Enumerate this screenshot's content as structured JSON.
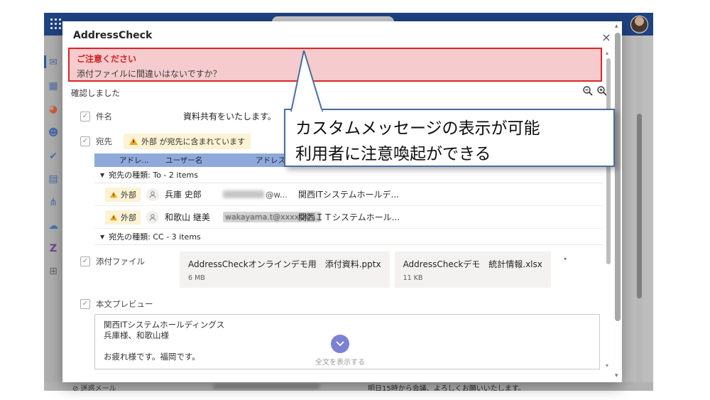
{
  "header": {
    "app_launcher": "app-launcher",
    "search_placeholder": ""
  },
  "sidebar": {
    "items": [
      {
        "name": "mail",
        "glyph": "✉"
      },
      {
        "name": "calendar",
        "glyph": "▦"
      },
      {
        "name": "office",
        "glyph": "◕"
      },
      {
        "name": "people",
        "glyph": "☻"
      },
      {
        "name": "todo",
        "glyph": "✔"
      },
      {
        "name": "notebook",
        "glyph": "▤"
      },
      {
        "name": "org",
        "glyph": "⋔"
      },
      {
        "name": "cloud",
        "glyph": "☁"
      },
      {
        "name": "app-z",
        "glyph": "Z"
      },
      {
        "name": "apps-grid",
        "glyph": "⊞"
      }
    ]
  },
  "dialog": {
    "title": "AddressCheck",
    "close_glyph": "×",
    "banner": {
      "title": "ご注意ください",
      "message": "添付ファイルに間違いはないですか？"
    },
    "confirmed_label": "確認しました",
    "subject": {
      "label": "件名",
      "value": "資料共有をいたします。"
    },
    "recipients": {
      "label": "宛先",
      "warning": "外部 が宛先に含まれています",
      "table_headers": [
        "アドレ...",
        "ユーザー名",
        "アドレス"
      ],
      "groups": [
        {
          "label": "宛先の種類: To - 2 items",
          "rows": [
            {
              "badge": "外部",
              "name": "兵庫 史郎",
              "email_visible": "@w...",
              "company": "関西ITシステムホールデ..."
            },
            {
              "badge": "外部",
              "name": "和歌山 継美",
              "email_visible": "wakayama.t@xxxxOO...",
              "company": "関西ＩＴシステムホール..."
            }
          ]
        },
        {
          "label": "宛先の種類: CC - 3 items"
        }
      ]
    },
    "attachments": {
      "label": "添付ファイル",
      "files": [
        {
          "name": "AddressCheckオンラインデモ用　添付資料.pptx",
          "size": "6 MB"
        },
        {
          "name": "AddressCheckデモ　統計情報.xlsx",
          "size": "11 KB"
        }
      ]
    },
    "body_preview": {
      "label": "本文プレビュー",
      "text": "関西ITシステムホールディングス\n兵庫様、和歌山様\n\nお疲れ様です。福岡です。",
      "expand_label": "全文を表示する"
    }
  },
  "callout": {
    "line1": "カスタムメッセージの表示が可能",
    "line2": "利用者に注意喚起ができる"
  },
  "background_page": {
    "junk_mail_label": "迷惑メール",
    "junk_icon_glyph": "⊘",
    "meeting_text": "明日15時から会議、よろしくお願いいたします。"
  },
  "glyphs": {
    "group_collapse": "▼",
    "scroll_up": "▴",
    "scroll_down": "▾"
  },
  "colors": {
    "header_blue": "#1f4280",
    "banner_border": "#e02424",
    "banner_bg": "#f5cbce",
    "banner_title": "#d42020",
    "warning_badge_bg": "#fbf3d4",
    "table_header_bg": "#8fa9db",
    "expand_button": "#7b82d4",
    "callout_border": "#4a6da0"
  }
}
